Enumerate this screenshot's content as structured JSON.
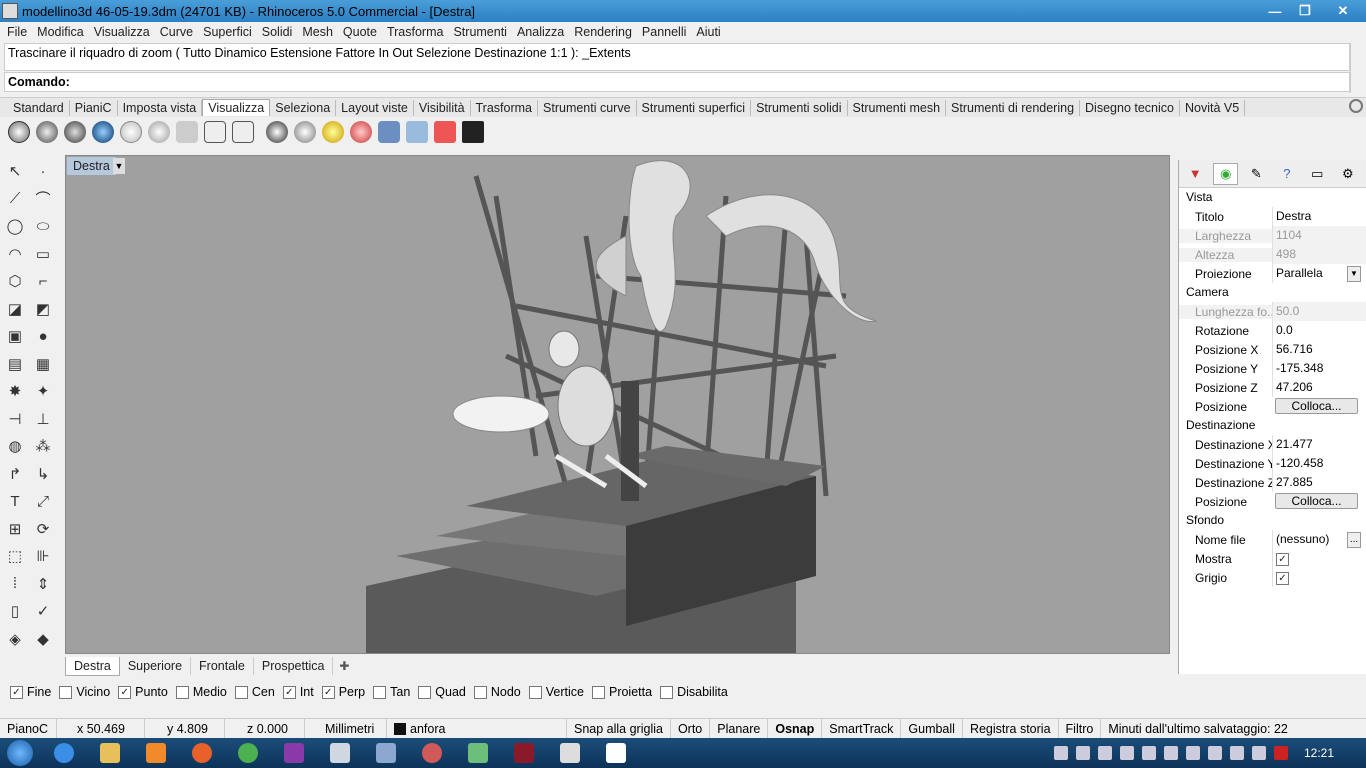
{
  "window": {
    "title": "modellino3d 46-05-19.3dm (24701 KB) - Rhinoceros 5.0 Commercial - [Destra]",
    "minimize": "—",
    "maximize": "❐",
    "close": "✕"
  },
  "menu": [
    "File",
    "Modifica",
    "Visualizza",
    "Curve",
    "Superfici",
    "Solidi",
    "Mesh",
    "Quote",
    "Trasforma",
    "Strumenti",
    "Analizza",
    "Rendering",
    "Pannelli",
    "Aiuti"
  ],
  "command": {
    "history": "Trascinare il riquadro di zoom ( Tutto  Dinamico  Estensione  Fattore  In  Out  Selezione  Destinazione  1:1 ): _Extents",
    "prompt": "Comando:"
  },
  "toolbar_tabs": [
    "Standard",
    "PianiC",
    "Imposta vista",
    "Visualizza",
    "Seleziona",
    "Layout viste",
    "Visibilità",
    "Trasforma",
    "Strumenti curve",
    "Strumenti superfici",
    "Strumenti solidi",
    "Strumenti mesh",
    "Strumenti di rendering",
    "Disegno tecnico",
    "Novità V5"
  ],
  "active_toolbar_tab": "Visualizza",
  "viewport": {
    "label": "Destra"
  },
  "viewport_tabs": [
    "Destra",
    "Superiore",
    "Frontale",
    "Prospettica"
  ],
  "osnaps": [
    {
      "label": "Fine",
      "checked": true
    },
    {
      "label": "Vicino",
      "checked": false
    },
    {
      "label": "Punto",
      "checked": true
    },
    {
      "label": "Medio",
      "checked": false
    },
    {
      "label": "Cen",
      "checked": false
    },
    {
      "label": "Int",
      "checked": true
    },
    {
      "label": "Perp",
      "checked": true
    },
    {
      "label": "Tan",
      "checked": false
    },
    {
      "label": "Quad",
      "checked": false
    },
    {
      "label": "Nodo",
      "checked": false
    },
    {
      "label": "Vertice",
      "checked": false
    },
    {
      "label": "Proietta",
      "checked": false
    },
    {
      "label": "Disabilita",
      "checked": false
    }
  ],
  "status": {
    "cplane": "PianoC",
    "x": "x 50.469",
    "y": "y 4.809",
    "z": "z 0.000",
    "units": "Millimetri",
    "layer": "anfora",
    "snap": "Snap alla griglia",
    "orto": "Orto",
    "planare": "Planare",
    "osnap": "Osnap",
    "smarttrack": "SmartTrack",
    "gumball": "Gumball",
    "history": "Registra storia",
    "filter": "Filtro",
    "saved": "Minuti dall'ultimo salvataggio: 22"
  },
  "panel": {
    "vista_title": "Vista",
    "titolo_label": "Titolo",
    "titolo_value": "Destra",
    "larghezza_label": "Larghezza",
    "larghezza_value": "1104",
    "altezza_label": "Altezza",
    "altezza_value": "498",
    "proiezione_label": "Proiezione",
    "proiezione_value": "Parallela",
    "camera_title": "Camera",
    "lunghezza_label": "Lunghezza fo...",
    "lunghezza_value": "50.0",
    "rotazione_label": "Rotazione",
    "rotazione_value": "0.0",
    "posx_label": "Posizione X",
    "posx_value": "56.716",
    "posy_label": "Posizione Y",
    "posy_value": "-175.348",
    "posz_label": "Posizione Z",
    "posz_value": "47.206",
    "posizione_label": "Posizione",
    "colloca_label": "Colloca...",
    "destinazione_title": "Destinazione",
    "destx_label": "Destinazione X",
    "destx_value": "21.477",
    "desty_label": "Destinazione Y",
    "desty_value": "-120.458",
    "destz_label": "Destinazione Z",
    "destz_value": "27.885",
    "posizione2_label": "Posizione",
    "colloca2_label": "Colloca...",
    "sfondo_title": "Sfondo",
    "nomefile_label": "Nome file",
    "nomefile_value": "(nessuno)",
    "browse_label": "...",
    "mostra_label": "Mostra",
    "grigio_label": "Grigio"
  },
  "taskbar": {
    "time": "12:21"
  },
  "colors": {
    "titlebar": "#2b7fc4",
    "viewport_bg": "#a0a0a0",
    "taskbar": "#1b4d7a"
  }
}
